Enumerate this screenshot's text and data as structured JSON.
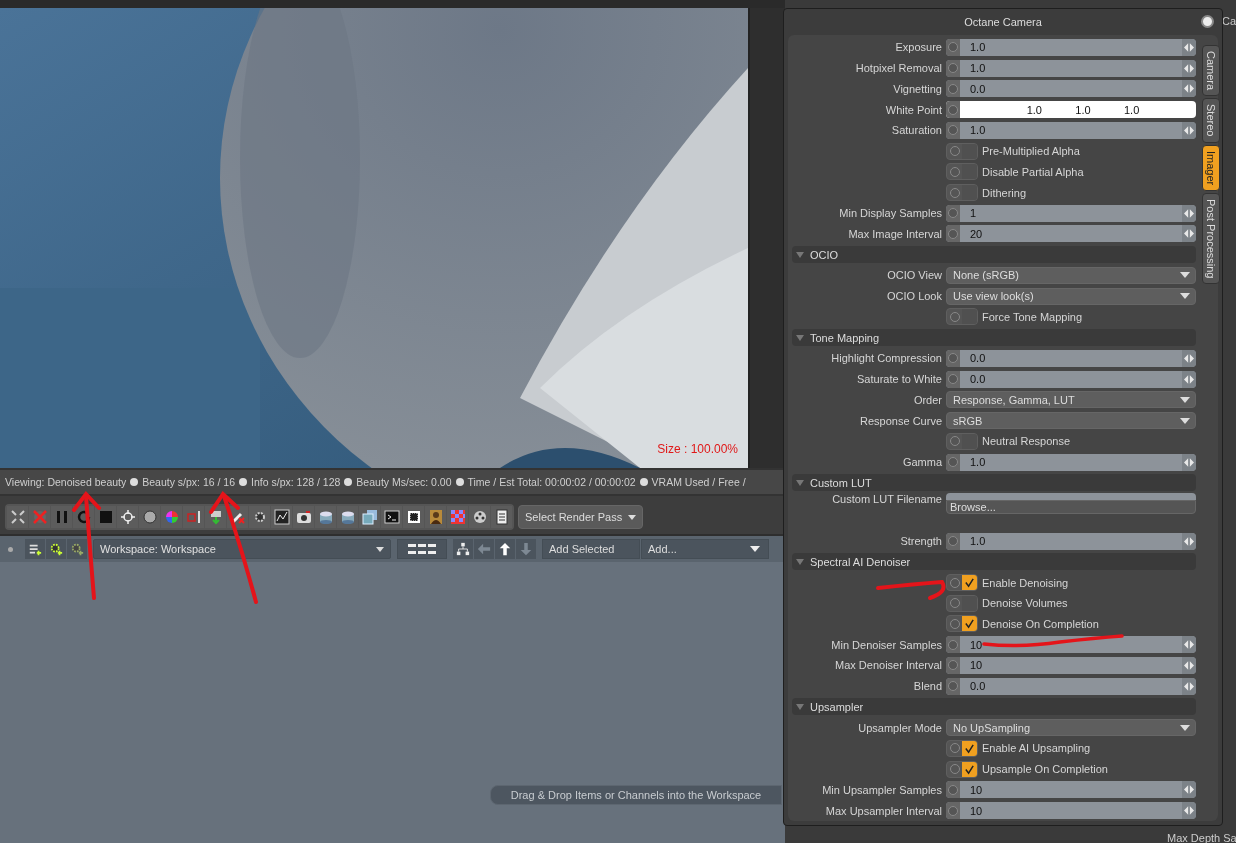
{
  "viewport": {
    "size_label": "Size : 100.00%"
  },
  "status_items": [
    "Viewing: Denoised beauty",
    "Beauty s/px: 16 / 16",
    "Info s/px: 128 / 128",
    "Beauty Ms/sec: 0.00",
    "Time / Est Total: 00:00:02 / 00:00:02",
    "VRAM Used / Free /"
  ],
  "toolbar": {
    "render_pass": "Select Render Pass"
  },
  "workspace_bar": {
    "workspace": "Workspace: Workspace",
    "add_selected": "Add Selected",
    "add_menu": "Add..."
  },
  "drop_hint": "Drag & Drop Items or Channels into the Workspace",
  "background_fragments": [
    "Ca",
    "Max Depth Sa"
  ],
  "panel": {
    "title": "Octane Camera",
    "tabs": [
      {
        "label": "Camera",
        "selected": false
      },
      {
        "label": "Stereo",
        "selected": false
      },
      {
        "label": "Imager",
        "selected": true
      },
      {
        "label": "Post Processing",
        "selected": false
      }
    ],
    "rows": [
      {
        "kind": "slider",
        "label": "Exposure",
        "value": "1.0"
      },
      {
        "kind": "slider",
        "label": "Hotpixel Removal",
        "value": "1.0"
      },
      {
        "kind": "slider",
        "label": "Vignetting",
        "value": "0.0"
      },
      {
        "kind": "color",
        "label": "White Point",
        "values": [
          "1.0",
          "1.0",
          "1.0"
        ]
      },
      {
        "kind": "slider",
        "label": "Saturation",
        "value": "1.0"
      },
      {
        "kind": "check",
        "label": "Pre-Multiplied Alpha",
        "checked": false
      },
      {
        "kind": "check",
        "label": "Disable Partial Alpha",
        "checked": false
      },
      {
        "kind": "check",
        "label": "Dithering",
        "checked": false
      },
      {
        "kind": "slider",
        "label": "Min Display Samples",
        "value": "1"
      },
      {
        "kind": "slider",
        "label": "Max Image Interval",
        "value": "20"
      },
      {
        "kind": "section",
        "label": "OCIO"
      },
      {
        "kind": "dropdown",
        "label": "OCIO View",
        "value": "None (sRGB)"
      },
      {
        "kind": "dropdown",
        "label": "OCIO Look",
        "value": "Use view look(s)"
      },
      {
        "kind": "check",
        "label": "Force Tone Mapping",
        "checked": false
      },
      {
        "kind": "section",
        "label": "Tone Mapping"
      },
      {
        "kind": "slider",
        "label": "Highlight Compression",
        "value": "0.0"
      },
      {
        "kind": "slider",
        "label": "Saturate to White",
        "value": "0.0"
      },
      {
        "kind": "dropdown",
        "label": "Order",
        "value": "Response, Gamma, LUT"
      },
      {
        "kind": "dropdown",
        "label": "Response Curve",
        "value": "sRGB"
      },
      {
        "kind": "check",
        "label": "Neutral Response",
        "checked": false
      },
      {
        "kind": "slider",
        "label": "Gamma",
        "value": "1.0"
      },
      {
        "kind": "section",
        "label": "Custom LUT"
      },
      {
        "kind": "file",
        "label": "Custom LUT Filename",
        "button": "Browse..."
      },
      {
        "kind": "slider",
        "label": "Strength",
        "value": "1.0"
      },
      {
        "kind": "section",
        "label": "Spectral AI Denoiser"
      },
      {
        "kind": "check",
        "label": "Enable Denoising",
        "checked": true
      },
      {
        "kind": "check",
        "label": "Denoise Volumes",
        "checked": false
      },
      {
        "kind": "check",
        "label": "Denoise On Completion",
        "checked": true
      },
      {
        "kind": "slider",
        "label": "Min Denoiser Samples",
        "value": "10"
      },
      {
        "kind": "slider",
        "label": "Max Denoiser Interval",
        "value": "10"
      },
      {
        "kind": "slider",
        "label": "Blend",
        "value": "0.0"
      },
      {
        "kind": "section",
        "label": "Upsampler"
      },
      {
        "kind": "dropdown",
        "label": "Upsampler Mode",
        "value": "No UpSampling"
      },
      {
        "kind": "check",
        "label": "Enable AI Upsampling",
        "checked": true
      },
      {
        "kind": "check",
        "label": "Upsample On Completion",
        "checked": true
      },
      {
        "kind": "slider",
        "label": "Min Upsampler Samples",
        "value": "10"
      },
      {
        "kind": "slider",
        "label": "Max Upsampler Interval",
        "value": "10"
      }
    ]
  }
}
